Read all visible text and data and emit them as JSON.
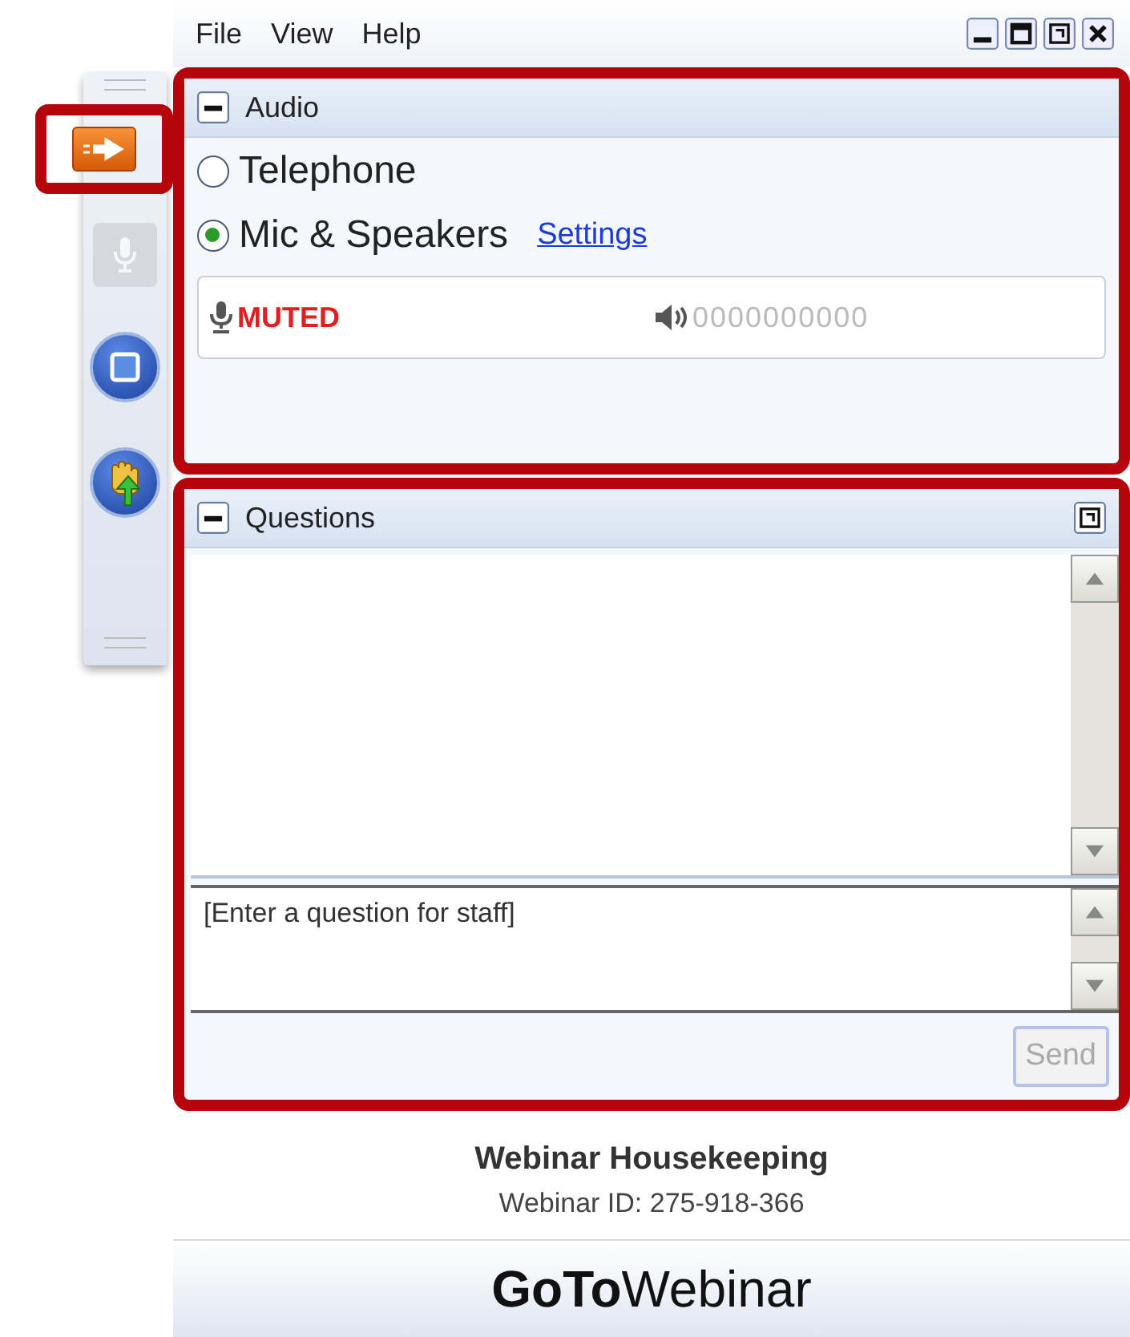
{
  "menu": [
    "File",
    "View",
    "Help"
  ],
  "sidebar": [
    {
      "kind": "arrow",
      "disabled": false,
      "highlighted": true
    },
    {
      "kind": "mic",
      "disabled": true,
      "highlighted": false
    },
    {
      "kind": "screen",
      "disabled": false,
      "highlighted": false
    },
    {
      "kind": "hand",
      "disabled": false,
      "highlighted": false
    }
  ],
  "audio": {
    "title": "Audio",
    "options": [
      {
        "label": "Telephone",
        "selected": false
      },
      {
        "label": "Mic & Speakers",
        "selected": true
      }
    ],
    "settings_link": "Settings",
    "mic_status": "MUTED",
    "speaker_meter": "0000000000"
  },
  "questions": {
    "title": "Questions",
    "placeholder": "[Enter a question for staff]",
    "send": "Send"
  },
  "footer": {
    "title": "Webinar Housekeeping",
    "webinar_id": "Webinar ID: 275-918-366",
    "logo": "**GoTo**Webinar"
  }
}
